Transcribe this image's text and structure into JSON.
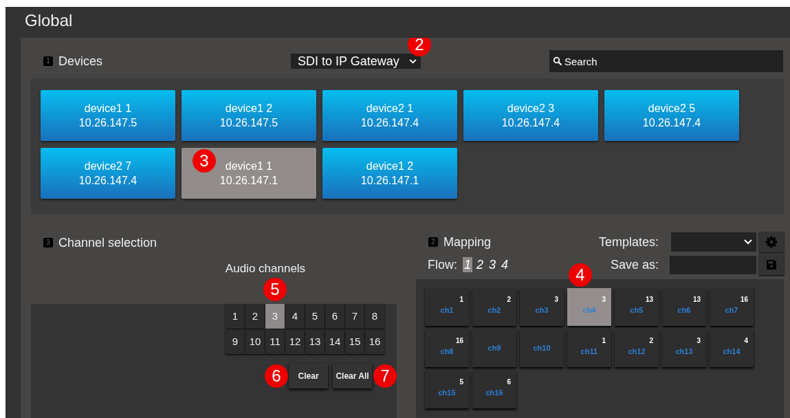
{
  "page_title": "Global",
  "devices": {
    "badge": "1",
    "title": "Devices",
    "selector": {
      "value": "SDI to IP Gateway",
      "callout": "2"
    },
    "search": {
      "placeholder": "Search"
    },
    "items": [
      {
        "name": "device1 1",
        "ip": "10.26.147.5",
        "selected": false
      },
      {
        "name": "device1 2",
        "ip": "10.26.147.5",
        "selected": false
      },
      {
        "name": "device2 1",
        "ip": "10.26.147.4",
        "selected": false
      },
      {
        "name": "device2 3",
        "ip": "10.26.147.4",
        "selected": false
      },
      {
        "name": "device2 5",
        "ip": "10.26.147.4",
        "selected": false
      },
      {
        "name": "device2 7",
        "ip": "10.26.147.4",
        "selected": false
      },
      {
        "name": "device1 1",
        "ip": "10.26.147.1",
        "selected": true,
        "callout": "3"
      },
      {
        "name": "device1 2",
        "ip": "10.26.147.1",
        "selected": false
      }
    ]
  },
  "channel_selection": {
    "badge": "3",
    "title": "Channel selection",
    "subtitle": "Audio channels",
    "channels": [
      {
        "label": "1",
        "selected": false
      },
      {
        "label": "2",
        "selected": false
      },
      {
        "label": "3",
        "selected": true,
        "callout": "5"
      },
      {
        "label": "4",
        "selected": false
      },
      {
        "label": "5",
        "selected": false
      },
      {
        "label": "6",
        "selected": false
      },
      {
        "label": "7",
        "selected": false
      },
      {
        "label": "8",
        "selected": false
      },
      {
        "label": "9",
        "selected": false
      },
      {
        "label": "10",
        "selected": false
      },
      {
        "label": "11",
        "selected": false
      },
      {
        "label": "12",
        "selected": false
      },
      {
        "label": "13",
        "selected": false
      },
      {
        "label": "14",
        "selected": false
      },
      {
        "label": "15",
        "selected": false
      },
      {
        "label": "16",
        "selected": false
      }
    ],
    "buttons": [
      {
        "kind": "callout",
        "label": "6"
      },
      {
        "kind": "button",
        "label": "Clear"
      },
      {
        "kind": "button",
        "label": "Clear All"
      },
      {
        "kind": "callout",
        "label": "7"
      }
    ]
  },
  "mapping": {
    "badge": "2",
    "title": "Mapping",
    "templates_label": "Templates:",
    "save_as_label": "Save as:",
    "flow_label": "Flow:",
    "flows": [
      {
        "label": "1",
        "selected": true
      },
      {
        "label": "2",
        "selected": false
      },
      {
        "label": "3",
        "selected": false
      },
      {
        "label": "4",
        "selected": false
      }
    ],
    "channels": [
      {
        "label": "ch1",
        "source": "1",
        "selected": false
      },
      {
        "label": "ch2",
        "source": "2",
        "selected": false
      },
      {
        "label": "ch3",
        "source": "3",
        "selected": false
      },
      {
        "label": "ch4",
        "source": "3",
        "selected": true,
        "callout": "4"
      },
      {
        "label": "ch5",
        "source": "13",
        "selected": false
      },
      {
        "label": "ch6",
        "source": "13",
        "selected": false
      },
      {
        "label": "ch7",
        "source": "16",
        "selected": false
      },
      {
        "label": "ch8",
        "source": "16",
        "selected": false
      },
      {
        "label": "ch9",
        "selected": false
      },
      {
        "label": "ch10",
        "selected": false
      },
      {
        "label": "ch11",
        "source": "1",
        "selected": false
      },
      {
        "label": "ch12",
        "source": "2",
        "selected": false
      },
      {
        "label": "ch13",
        "source": "3",
        "selected": false
      },
      {
        "label": "ch14",
        "source": "4",
        "selected": false
      },
      {
        "label": "ch15",
        "source": "5",
        "selected": false
      },
      {
        "label": "ch16",
        "source": "6",
        "selected": false
      }
    ]
  }
}
